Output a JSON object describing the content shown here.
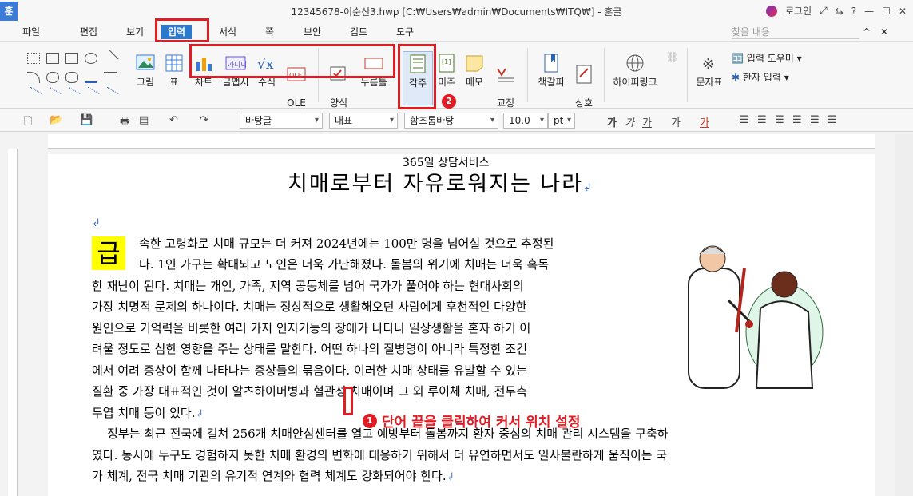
{
  "window": {
    "app_letter": "훈",
    "title": "12345678-이순신3.hwp [C:₩Users₩admin₩Documents₩ITQ₩] - 훈글",
    "login": "로그인"
  },
  "menu": {
    "items": [
      "파일",
      "편집",
      "보기",
      "입력",
      "서식",
      "쪽",
      "보안",
      "검토",
      "도구"
    ],
    "active_index": 3,
    "search_placeholder": "찾을 내용"
  },
  "ribbon": {
    "buttons": [
      {
        "label": "그림"
      },
      {
        "label": "표"
      },
      {
        "label": "차트"
      },
      {
        "label": "글맵시"
      },
      {
        "label": "수식"
      },
      {
        "label": "OLE\n개체"
      },
      {
        "label": "양식\n개체"
      },
      {
        "label": "누름틀"
      },
      {
        "label": "각주"
      },
      {
        "label": "미주"
      },
      {
        "label": "메모"
      },
      {
        "label": "교정\n부호"
      },
      {
        "label": "책갈피"
      },
      {
        "label": "상호\n참조"
      },
      {
        "label": "하이퍼링크"
      },
      {
        "label": "문자표"
      }
    ],
    "side_items": [
      "입력 도우미",
      "한자 입력"
    ],
    "badge_2": "2"
  },
  "format": {
    "style": "바탕글",
    "font_group": "대표",
    "font": "함초롬바탕",
    "size": "10.0",
    "size_unit": "pt"
  },
  "document": {
    "pre_heading": "365일 상담서비스",
    "heading": "치매로부터 자유로워지는 나라",
    "dropcap": "급",
    "lines": [
      "속한 고령화로 치매 규모는 더 커져 2024년에는 100만 명을 넘어설 것으로 추정된",
      "다. 1인 가구는 확대되고 노인은 더욱 가난해졌다. 돌봄의 위기에 치매는 더욱 혹독",
      "한 재난이 된다. 치매는 개인, 가족, 지역 공동체를 넘어 국가가 풀어야 하는 현대사회의",
      "가장 치명적 문제의 하나이다. 치매는 정상적으로 생활해오던 사람에게 후천적인 다양한",
      "원인으로 기억력을 비롯한 여러 가지 인지기능의 장애가 나타나 일상생활을 혼자 하기 어",
      "려울 정도로 심한 영향을 주는 상태를 말한다. 어떤 하나의 질병명이 아니라 특정한 조건",
      "에서 여려 증상이 함께 나타나는 증상들의 묶음이다. 이러한 치매 상태를 유발할 수 있는",
      "질환 중 가장 대표적인 것이 알츠하이머병과 혈관성 치매이며 그 외 루이체 치매, 전두측",
      "두엽 치매 등이 있다."
    ],
    "lines2": [
      "정부는 최근 전국에 걸쳐 256개 치매안심센터를 열고 예방부터 돌봄까지 환자 중심의 치매 관리 시스템을 구축하",
      "였다. 동시에 누구도 경험하지 못한 치매 환경의 변화에 대응하기 위해서 더 유연하면서도 일사불란하게 움직이는 국",
      "가 체계, 전국 치매 기관의 유기적 연계와 협력 체계도 강화되어야 한다."
    ],
    "annotation_badge": "1",
    "annotation": "단어 끝을 클릭하여 커서 위치 설정"
  },
  "colors": {
    "accent": "#2b78d0",
    "highlight": "#e01d24",
    "dropcap_bg": "#ffff00"
  }
}
